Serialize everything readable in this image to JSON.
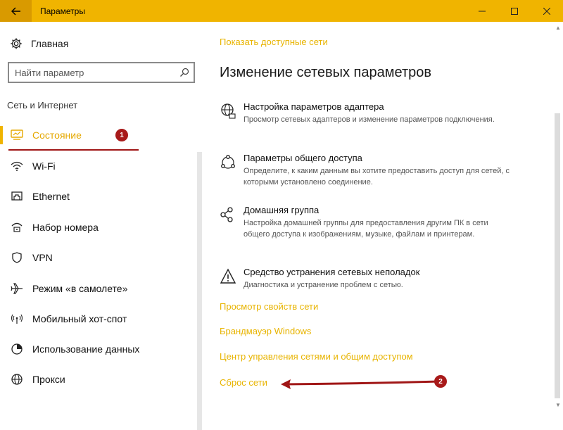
{
  "window": {
    "title": "Параметры",
    "back_icon": "arrow-left-icon",
    "controls": [
      "minimize-icon",
      "maximize-icon",
      "close-icon"
    ],
    "accent": "#f0b400"
  },
  "sidebar": {
    "home_label": "Главная",
    "search_placeholder": "Найти параметр",
    "section_title": "Сеть и Интернет",
    "items": [
      {
        "label": "Состояние",
        "icon": "status-icon",
        "active": true
      },
      {
        "label": "Wi-Fi",
        "icon": "wifi-icon"
      },
      {
        "label": "Ethernet",
        "icon": "ethernet-icon"
      },
      {
        "label": "Набор номера",
        "icon": "dialup-icon"
      },
      {
        "label": "VPN",
        "icon": "vpn-icon"
      },
      {
        "label": "Режим «в самолете»",
        "icon": "airplane-icon"
      },
      {
        "label": "Мобильный хот-спот",
        "icon": "hotspot-icon"
      },
      {
        "label": "Использование данных",
        "icon": "data-usage-icon"
      },
      {
        "label": "Прокси",
        "icon": "globe-icon"
      }
    ]
  },
  "annotations": {
    "badge1": "1",
    "badge2": "2",
    "color": "#a01616"
  },
  "main": {
    "top_link": "Показать доступные сети",
    "heading": "Изменение сетевых параметров",
    "settings": [
      {
        "title": "Настройка параметров адаптера",
        "desc": "Просмотр сетевых адаптеров и изменение параметров подключения.",
        "icon": "adapter-globe-icon"
      },
      {
        "title": "Параметры общего доступа",
        "desc": "Определите, к каким данным вы хотите предоставить доступ для сетей, с которыми установлено соединение.",
        "icon": "sharing-icon"
      },
      {
        "title": "Домашняя группа",
        "desc": "Настройка домашней группы для предоставления другим ПК в сети общего доступа к изображениям, музыке, файлам и принтерам.",
        "icon": "homegroup-icon"
      },
      {
        "title": "Средство устранения сетевых неполадок",
        "desc": "Диагностика и устранение проблем с сетью.",
        "icon": "warning-icon"
      }
    ],
    "links": [
      "Просмотр свойств сети",
      "Брандмауэр Windows",
      "Центр управления сетями и общим доступом",
      "Сброс сети"
    ]
  }
}
